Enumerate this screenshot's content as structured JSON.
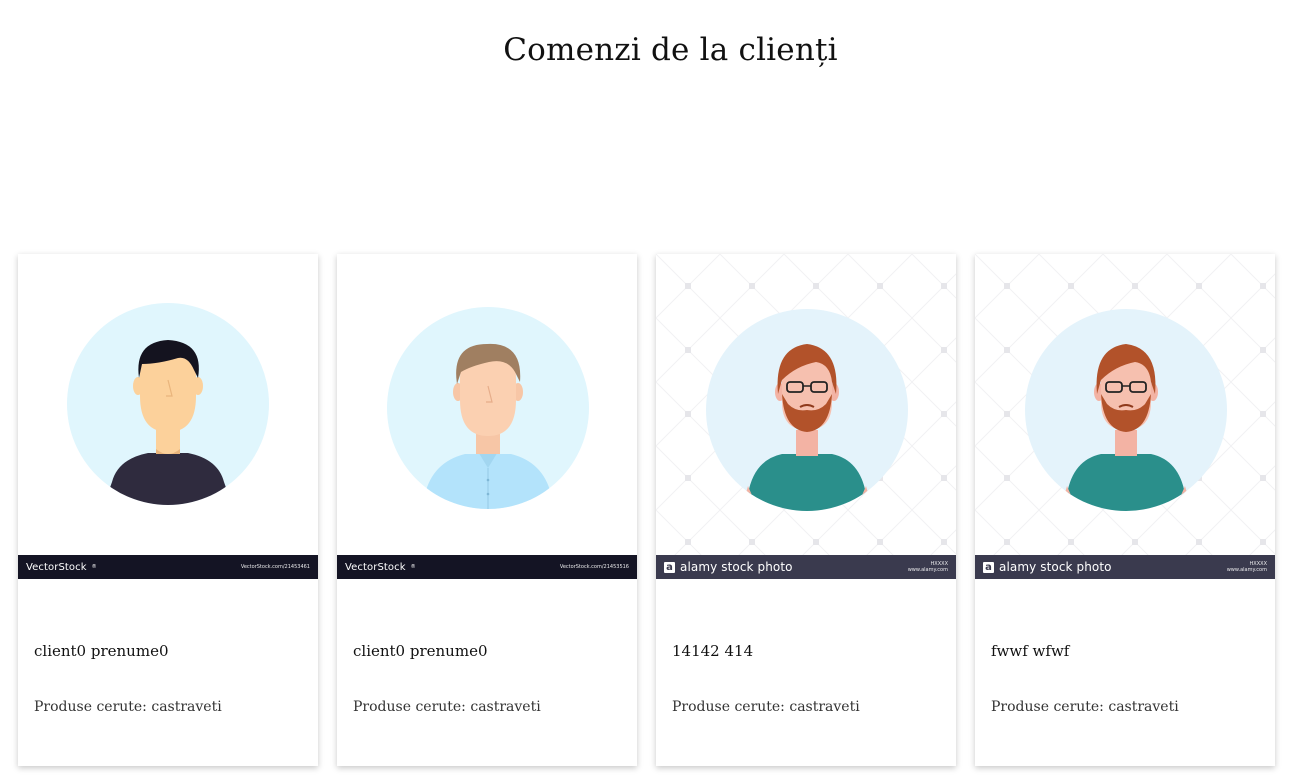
{
  "page": {
    "title": "Comenzi de la clienți"
  },
  "cards": [
    {
      "name": "client0 prenume0",
      "products_label": "Produse cerute:",
      "products": "castraveti",
      "avatar": "man-black-hair-dark-shirt-icon",
      "watermark": {
        "brand": "VectorStock",
        "registered": "®",
        "url": "VectorStock.com/21453461"
      }
    },
    {
      "name": "client0 prenume0",
      "products_label": "Produse cerute:",
      "products": "castraveti",
      "avatar": "man-brown-hair-light-blue-shirt-icon",
      "watermark": {
        "brand": "VectorStock",
        "registered": "®",
        "url": "VectorStock.com/21453516"
      }
    },
    {
      "name": "14142 414",
      "products_label": "Produse cerute:",
      "products": "castraveti",
      "avatar": "bearded-man-glasses-teal-shirt-icon",
      "watermark": {
        "brand": "alamy stock photo",
        "line1": "HXXXX",
        "line2": "www.alamy.com"
      }
    },
    {
      "name": "fwwf wfwf",
      "products_label": "Produse cerute:",
      "products": "castraveti",
      "avatar": "bearded-man-glasses-teal-shirt-icon",
      "watermark": {
        "brand": "alamy stock photo",
        "line1": "HXXXX",
        "line2": "www.alamy.com"
      }
    }
  ],
  "colors": {
    "avatar_bg_circle": "#e0f6fd",
    "vector_bar": "#141424",
    "alamy_bar": "#3a3a4e",
    "teal_shirt": "#2a8f8b",
    "beard": "#b2522a"
  }
}
